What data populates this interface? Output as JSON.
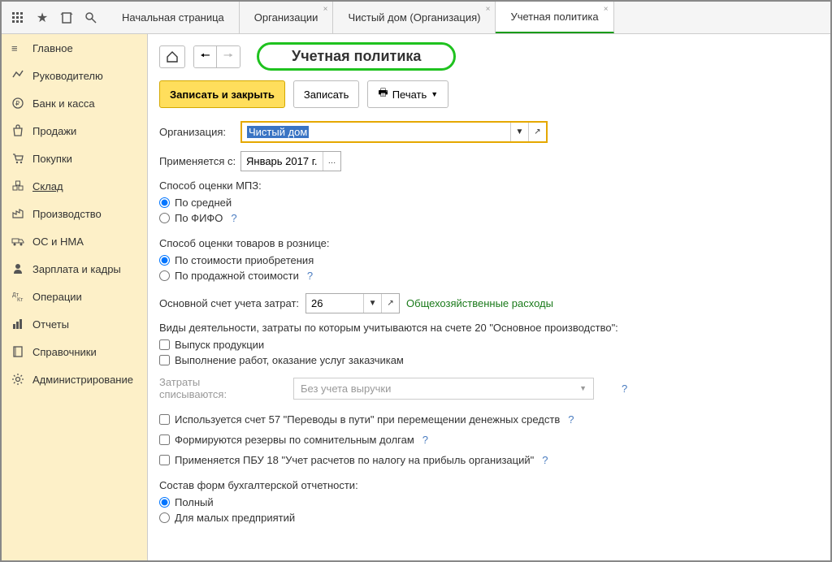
{
  "topIcons": [
    "apps-icon",
    "star-icon",
    "history-icon",
    "search-icon"
  ],
  "tabs": [
    {
      "label": "Начальная страница",
      "closable": false
    },
    {
      "label": "Организации",
      "closable": true
    },
    {
      "label": "Чистый дом (Организация)",
      "closable": true
    },
    {
      "label": "Учетная политика",
      "closable": true,
      "active": true
    }
  ],
  "sidebar": [
    {
      "label": "Главное",
      "icon": "menu"
    },
    {
      "label": "Руководителю",
      "icon": "chart"
    },
    {
      "label": "Банк и касса",
      "icon": "ruble"
    },
    {
      "label": "Продажи",
      "icon": "bag"
    },
    {
      "label": "Покупки",
      "icon": "cart"
    },
    {
      "label": "Склад",
      "icon": "boxes",
      "active": true
    },
    {
      "label": "Производство",
      "icon": "factory"
    },
    {
      "label": "ОС и НМА",
      "icon": "truck"
    },
    {
      "label": "Зарплата и кадры",
      "icon": "person"
    },
    {
      "label": "Операции",
      "icon": "ops"
    },
    {
      "label": "Отчеты",
      "icon": "barchart"
    },
    {
      "label": "Справочники",
      "icon": "book"
    },
    {
      "label": "Администрирование",
      "icon": "gear"
    }
  ],
  "pageTitle": "Учетная политика",
  "buttons": {
    "saveClose": "Записать и закрыть",
    "save": "Записать",
    "print": "Печать"
  },
  "form": {
    "orgLabel": "Организация:",
    "orgValue": "Чистый дом",
    "dateLabel": "Применяется с:",
    "dateValue": "Январь 2017 г.",
    "mpzLabel": "Способ оценки МПЗ:",
    "mpzOpt1": "По средней",
    "mpzOpt2": "По ФИФО",
    "retailLabel": "Способ оценки товаров в рознице:",
    "retailOpt1": "По стоимости приобретения",
    "retailOpt2": "По продажной стоимости",
    "mainAcctLabel": "Основной счет учета затрат:",
    "mainAcctVal": "26",
    "mainAcctDesc": "Общехозяйственные расходы",
    "activitiesLabel": "Виды деятельности, затраты по которым учитываются на счете 20 \"Основное производство\":",
    "chk1": "Выпуск продукции",
    "chk2": "Выполнение работ, оказание услуг заказчикам",
    "writeOffLabel": "Затраты списываются:",
    "writeOffVal": "Без учета выручки",
    "chk3": "Используется счет 57 \"Переводы в пути\" при перемещении денежных средств",
    "chk4": "Формируются резервы по сомнительным долгам",
    "chk5": "Применяется ПБУ 18 \"Учет расчетов по налогу на прибыль организаций\"",
    "reportFormsLabel": "Состав форм бухгалтерской отчетности:",
    "reportOpt1": "Полный",
    "reportOpt2": "Для малых предприятий"
  }
}
